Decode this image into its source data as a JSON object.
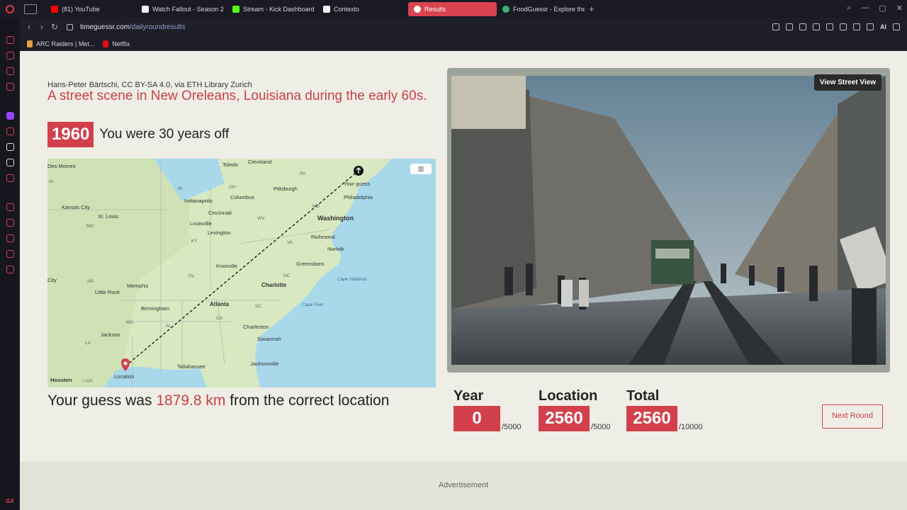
{
  "browser": {
    "tabs": [
      {
        "label": "(81) YouTube",
        "color": "#ff0000"
      },
      {
        "label": "Watch Fallout - Season 2",
        "color": "#f2f2f2"
      },
      {
        "label": "Stream - Kick Dashboard",
        "color": "#53fc18"
      },
      {
        "label": "Contexto",
        "color": "#f2f2f2"
      },
      {
        "label": "Results",
        "color": "#ffffff",
        "active": true
      },
      {
        "label": "FoodGuessr - Explore the",
        "color": "#3cb371"
      }
    ],
    "url_host": "timeguessr.com",
    "url_path": "/dailyroundresults",
    "ai_label": "AI",
    "bookmarks": [
      {
        "label": "ARC Raiders | Met...",
        "color": "#e8a040"
      },
      {
        "label": "Netflix",
        "color": "#e50914"
      }
    ],
    "sidebar_bottom": "GX"
  },
  "result": {
    "credit": "Hans-Peter Bärtschi, CC BY-SA 4.0, via ETH Library Zurich",
    "title": "A street scene in New Oreleans, Louisiana during the early 60s.",
    "year": "1960",
    "years_off": "You were 30 years off",
    "distance_prefix": "Your guess was ",
    "distance_value": "1879.8 km",
    "distance_suffix": " from the correct location",
    "view_street_view": "View Street View",
    "next_round": "Next Round",
    "advertisement": "Advertisement"
  },
  "scores": {
    "year": {
      "label": "Year",
      "value": "0",
      "max": "/5000"
    },
    "location": {
      "label": "Location",
      "value": "2560",
      "max": "/5000"
    },
    "total": {
      "label": "Total",
      "value": "2560",
      "max": "/10000"
    }
  },
  "map": {
    "guess_label": "Your guess",
    "location_label": "Location",
    "legal": "Legal",
    "cities": [
      "Des Moines",
      "Toledo",
      "Cleveland",
      "Indianapolis",
      "Columbus",
      "Pittsburgh",
      "Philadelphia",
      "Kansas City",
      "St. Louis",
      "Cincinnati",
      "Louisville",
      "Lexington",
      "Washington",
      "Richmond",
      "Norfolk",
      "Knoxville",
      "Greensboro",
      "Charlotte",
      "Memphis",
      "Little Rock",
      "Atlanta",
      "Birmingham",
      "Charleston",
      "Savannah",
      "Jackson",
      "Tallahassee",
      "Jacksonville",
      "Houston",
      "City"
    ],
    "states": [
      "IA",
      "IN",
      "OH",
      "PA",
      "MO",
      "WV",
      "MD",
      "KY",
      "VA",
      "TN",
      "NC",
      "AR",
      "SC",
      "MS",
      "AL",
      "GA",
      "LA"
    ],
    "water_labels": [
      "Cape Hatteras",
      "Cape Fear"
    ]
  }
}
